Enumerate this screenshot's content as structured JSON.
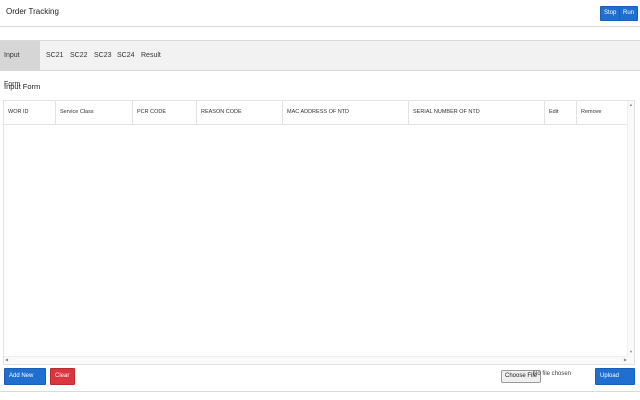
{
  "app": {
    "title": "Order Tracking",
    "stop_label": "Stop",
    "run_label": "Run"
  },
  "tabs": [
    {
      "label": "Input Form",
      "active": true
    },
    {
      "label": "SC21",
      "active": false
    },
    {
      "label": "SC22",
      "active": false
    },
    {
      "label": "SC23",
      "active": false
    },
    {
      "label": "SC24",
      "active": false
    },
    {
      "label": "Result",
      "active": false
    }
  ],
  "section": {
    "title": "Input Form"
  },
  "table": {
    "columns": [
      "WOR ID",
      "Service Class",
      "PCR CODE",
      "REASON CODE",
      "MAC ADDRESS OF NTD",
      "SERIAL NUMBER OF NTD",
      "Edit",
      "Remove"
    ],
    "rows": []
  },
  "footer": {
    "add_label": "Add New Order",
    "clear_label": "Clear All",
    "choose_file_label": "Choose File",
    "file_status": "No file chosen",
    "upload_label": "Upload Orders"
  },
  "colors": {
    "primary": "#1f6fd0",
    "danger": "#d9363e",
    "active_tab": "#d6d6d6",
    "tab_bar": "#f2f2f2"
  }
}
